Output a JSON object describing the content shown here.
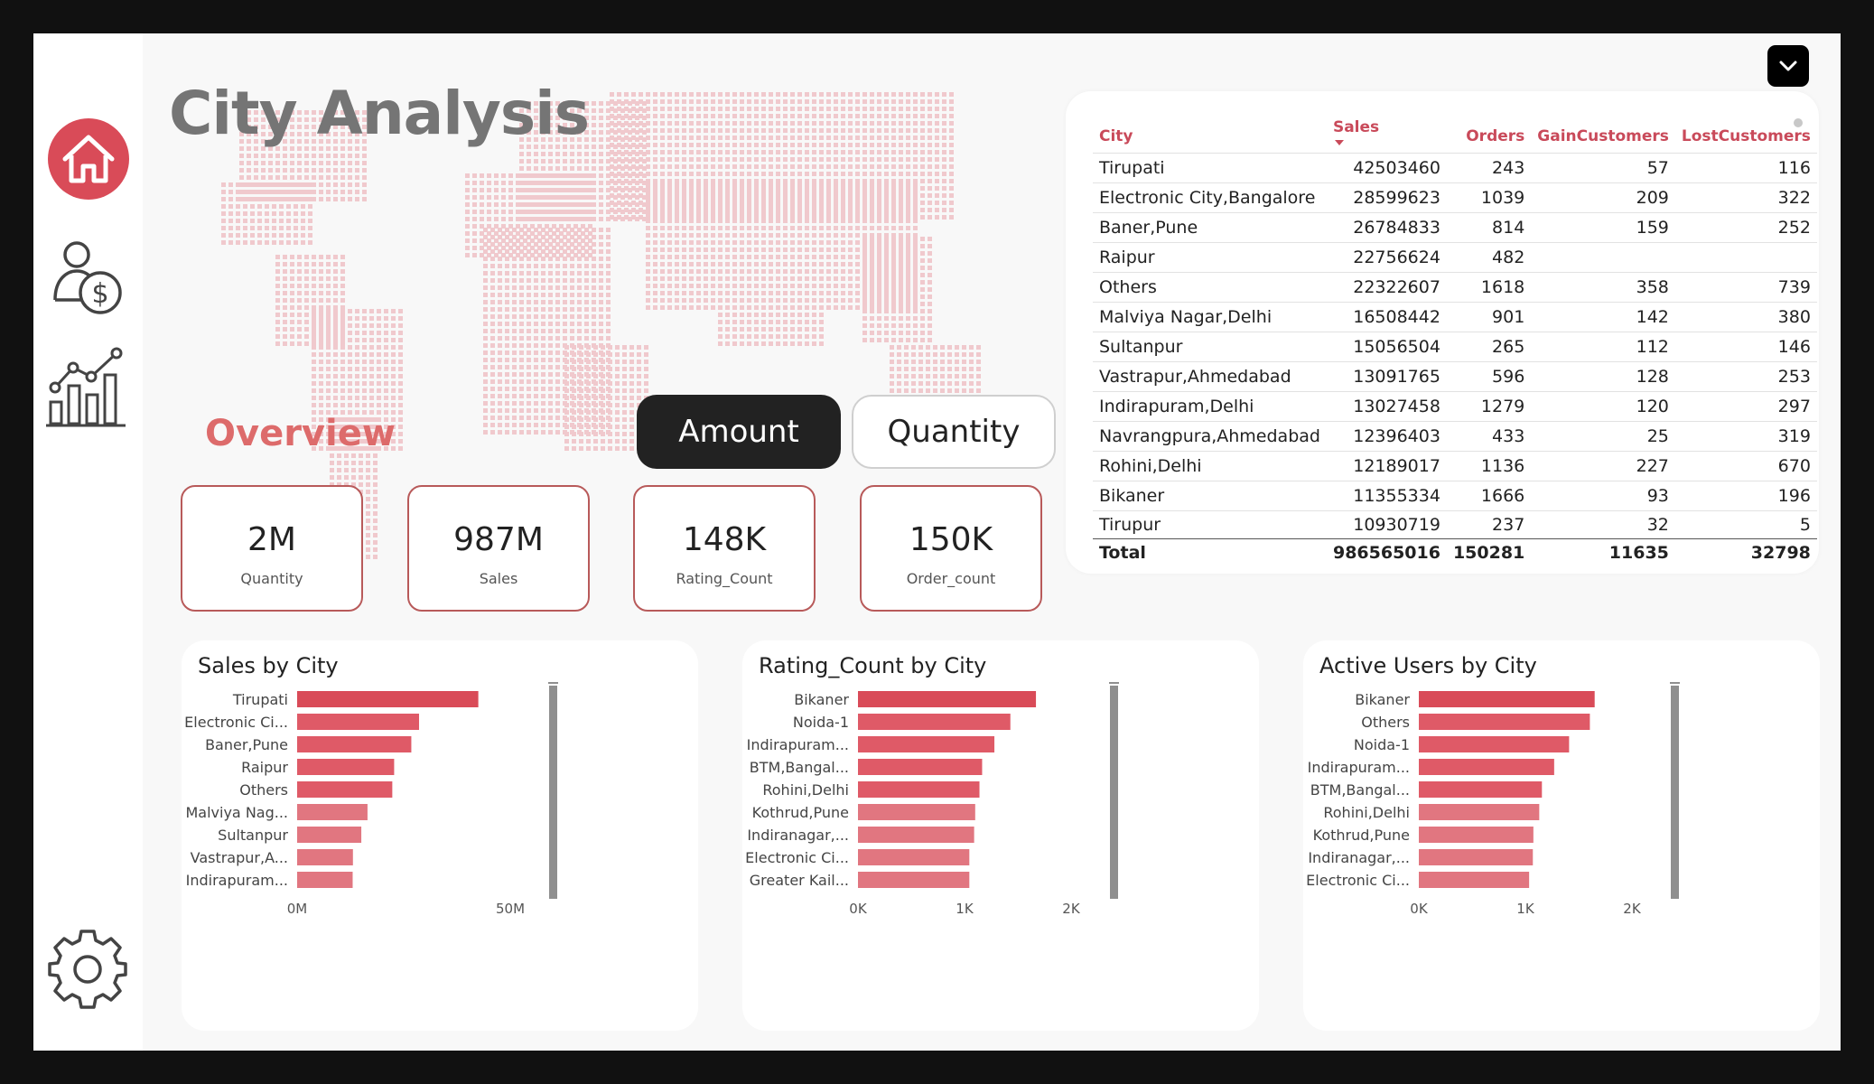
{
  "page_title": "City Analysis",
  "overview_label": "Overview",
  "toggle": {
    "amount": "Amount",
    "quantity": "Quantity",
    "selected": "Amount"
  },
  "kpis": [
    {
      "value": "2M",
      "label": "Quantity"
    },
    {
      "value": "987M",
      "label": "Sales"
    },
    {
      "value": "148K",
      "label": "Rating_Count"
    },
    {
      "value": "150K",
      "label": "Order_count"
    }
  ],
  "nav_icons": [
    "home-icon",
    "customer-revenue-icon",
    "analytics-chart-icon",
    "settings-gear-icon"
  ],
  "dropdown_icon": "chevron-down-icon",
  "colors": {
    "accent": "#d94b58",
    "bar": "#df5a67",
    "dark": "#222222",
    "kpi_border": "#b85a5a"
  },
  "table": {
    "columns": [
      "City",
      "Sales",
      "Orders",
      "GainCustomers",
      "LostCustomers"
    ],
    "sorted_column": "Sales",
    "rows": [
      [
        "Tirupati",
        "42503460",
        "243",
        "57",
        "116"
      ],
      [
        "Electronic City,Bangalore",
        "28599623",
        "1039",
        "209",
        "322"
      ],
      [
        "Baner,Pune",
        "26784833",
        "814",
        "159",
        "252"
      ],
      [
        "Raipur",
        "22756624",
        "482",
        "",
        ""
      ],
      [
        "Others",
        "22322607",
        "1618",
        "358",
        "739"
      ],
      [
        "Malviya Nagar,Delhi",
        "16508442",
        "901",
        "142",
        "380"
      ],
      [
        "Sultanpur",
        "15056504",
        "265",
        "112",
        "146"
      ],
      [
        "Vastrapur,Ahmedabad",
        "13091765",
        "596",
        "128",
        "253"
      ],
      [
        "Indirapuram,Delhi",
        "13027458",
        "1279",
        "120",
        "297"
      ],
      [
        "Navrangpura,Ahmedabad",
        "12396403",
        "433",
        "25",
        "319"
      ],
      [
        "Rohini,Delhi",
        "12189017",
        "1136",
        "227",
        "670"
      ],
      [
        "Bikaner",
        "11355334",
        "1666",
        "93",
        "196"
      ],
      [
        "Tirupur",
        "10930719",
        "237",
        "32",
        "5"
      ]
    ],
    "total": [
      "Total",
      "986565016",
      "150281",
      "11635",
      "32798"
    ]
  },
  "chart_data": [
    {
      "type": "bar",
      "orientation": "horizontal",
      "title": "Sales by City",
      "categories": [
        "Tirupati",
        "Electronic Ci...",
        "Baner,Pune",
        "Raipur",
        "Others",
        "Malviya Nag...",
        "Sultanpur",
        "Vastrapur,A...",
        "Indirapuram..."
      ],
      "values": [
        42503460,
        28599623,
        26784833,
        22756624,
        22322607,
        16508442,
        15056504,
        13091765,
        13027458
      ],
      "xlim": [
        0,
        50000000
      ],
      "ticks": [
        {
          "v": 0,
          "label": "0M"
        },
        {
          "v": 50000000,
          "label": "50M"
        }
      ],
      "grid": false
    },
    {
      "type": "bar",
      "orientation": "horizontal",
      "title": "Rating_Count by City",
      "categories": [
        "Bikaner",
        "Noida-1",
        "Indirapuram...",
        "BTM,Bangal...",
        "Rohini,Delhi",
        "Kothrud,Pune",
        "Indiranagar,...",
        "Electronic Ci...",
        "Greater Kail..."
      ],
      "values": [
        1670,
        1430,
        1280,
        1165,
        1140,
        1100,
        1090,
        1045,
        1045
      ],
      "xlim": [
        0,
        2000
      ],
      "ticks": [
        {
          "v": 0,
          "label": "0K"
        },
        {
          "v": 1000,
          "label": "1K"
        },
        {
          "v": 2000,
          "label": "2K"
        }
      ],
      "grid": false
    },
    {
      "type": "bar",
      "orientation": "horizontal",
      "title": "Active Users by City",
      "categories": [
        "Bikaner",
        "Others",
        "Noida-1",
        "Indirapuram...",
        "BTM,Bangal...",
        "Rohini,Delhi",
        "Kothrud,Pune",
        "Indiranagar,...",
        "Electronic Ci..."
      ],
      "values": [
        1650,
        1605,
        1410,
        1270,
        1155,
        1130,
        1075,
        1070,
        1035
      ],
      "xlim": [
        0,
        2000
      ],
      "ticks": [
        {
          "v": 0,
          "label": "0K"
        },
        {
          "v": 1000,
          "label": "1K"
        },
        {
          "v": 2000,
          "label": "2K"
        }
      ],
      "grid": false
    }
  ]
}
